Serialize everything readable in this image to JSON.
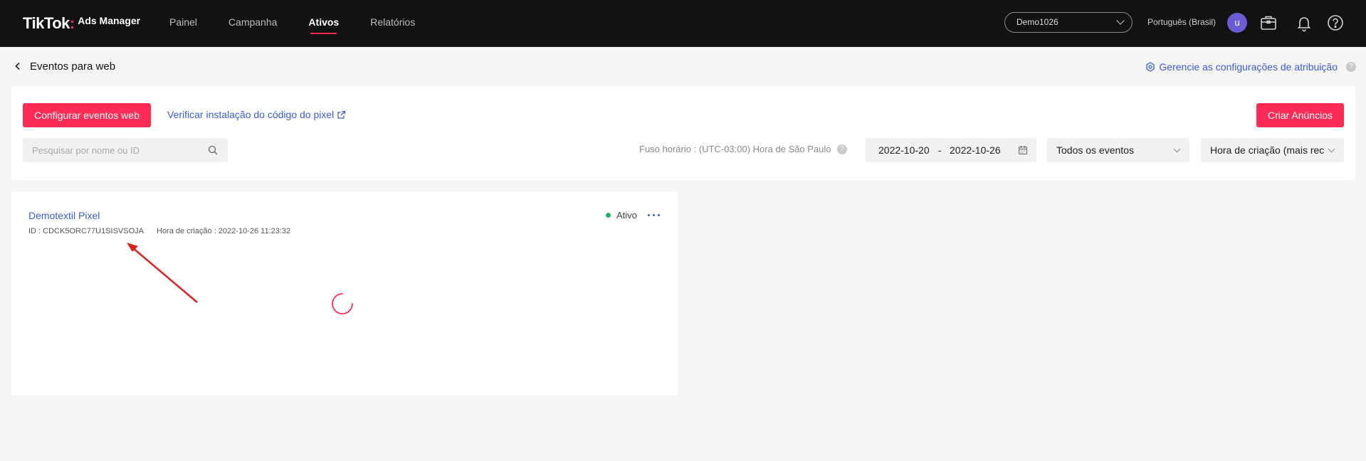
{
  "brand": {
    "name": "TikTok",
    "sub": "Ads Manager"
  },
  "nav": [
    {
      "label": "Painel"
    },
    {
      "label": "Campanha"
    },
    {
      "label": "Ativos"
    },
    {
      "label": "Relatórios"
    }
  ],
  "topbar": {
    "account": "Demo1026",
    "language": "Português (Brasil)",
    "avatar_letter": "u"
  },
  "page": {
    "title": "Eventos para web",
    "attribution_link": "Gerencie as configurações de atribuição"
  },
  "toolbar": {
    "configure_button": "Configurar eventos web",
    "verify_link": "Verificar instalação do código do pixel",
    "create_ads_button": "Criar Anúncios",
    "search_placeholder": "Pesquisar por nome ou ID",
    "timezone": "Fuso horário : (UTC-03:00) Hora de São Paulo",
    "date_start": "2022-10-20",
    "date_sep": "-",
    "date_end": "2022-10-26",
    "events_filter": "Todos os eventos",
    "sort_filter": "Hora de criação (mais rec"
  },
  "pixel": {
    "name": "Demotextil Pixel",
    "id_text": "ID : CDCK5ORC77U1SISVSOJA",
    "created_text": "Hora de criação : 2022-10-26 11:23:32",
    "status": "Ativo"
  },
  "colors": {
    "accent": "#fe2c55",
    "link": "#3a5bd9",
    "active_status": "#1fb36b",
    "topbar": "#121212",
    "annotation_arrow": "#e0201c"
  }
}
